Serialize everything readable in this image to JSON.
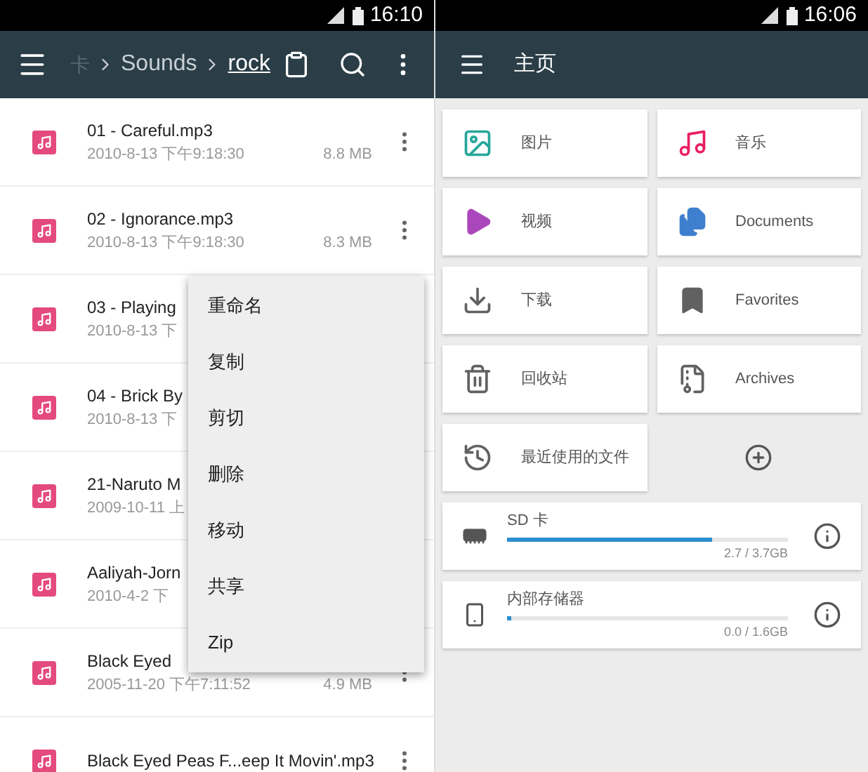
{
  "left_screen": {
    "status_bar": {
      "time": "16:10"
    },
    "toolbar": {
      "breadcrumbs": [
        {
          "label": "卡",
          "selected": false
        },
        {
          "label": "Sounds",
          "selected": false
        },
        {
          "label": "rock",
          "selected": true
        }
      ]
    },
    "files": [
      {
        "title": "01 - Careful.mp3",
        "date": "2010-8-13 下午9:18:30",
        "size": "8.8 MB"
      },
      {
        "title": "02 - Ignorance.mp3",
        "date": "2010-8-13 下午9:18:30",
        "size": "8.3 MB"
      },
      {
        "title": "03 - Playing",
        "date": "2010-8-13 下"
      },
      {
        "title": "04 - Brick By",
        "date": "2010-8-13 下"
      },
      {
        "title": "21-Naruto M",
        "date": "2009-10-11 上"
      },
      {
        "title": "Aaliyah-Jorn",
        "date": "2010-4-2 下"
      },
      {
        "title": "Black Eyed",
        "date": "2005-11-20 下午7:11:52",
        "size": "4.9 MB"
      },
      {
        "title": "Black Eyed Peas F...eep It Movin'.mp3"
      }
    ],
    "context_menu": [
      "重命名",
      "复制",
      "剪切",
      "删除",
      "移动",
      "共享",
      "Zip"
    ]
  },
  "right_screen": {
    "status_bar": {
      "time": "16:06"
    },
    "toolbar": {
      "title": "主页"
    },
    "tiles": [
      {
        "kind": "images",
        "label": "图片",
        "color": "#26a69a"
      },
      {
        "kind": "music",
        "label": "音乐",
        "color": "#e91e63"
      },
      {
        "kind": "videos",
        "label": "视频",
        "color": "#ab47bc"
      },
      {
        "kind": "documents",
        "label": "Documents",
        "color": "#3f7fcf"
      },
      {
        "kind": "downloads",
        "label": "下载",
        "color": "#616161"
      },
      {
        "kind": "favorites",
        "label": "Favorites",
        "color": "#616161"
      },
      {
        "kind": "trash",
        "label": "回收站",
        "color": "#616161"
      },
      {
        "kind": "archives",
        "label": "Archives",
        "color": "#616161"
      },
      {
        "kind": "recent",
        "label": "最近使用的文件",
        "color": "#616161"
      }
    ],
    "storage": [
      {
        "kind": "sd",
        "name": "SD 卡",
        "level": 0.73,
        "reading": "2.7 / 3.7GB"
      },
      {
        "kind": "internal",
        "name": "内部存储器",
        "level": 0.01,
        "reading": "0.0 / 1.6GB"
      }
    ]
  }
}
